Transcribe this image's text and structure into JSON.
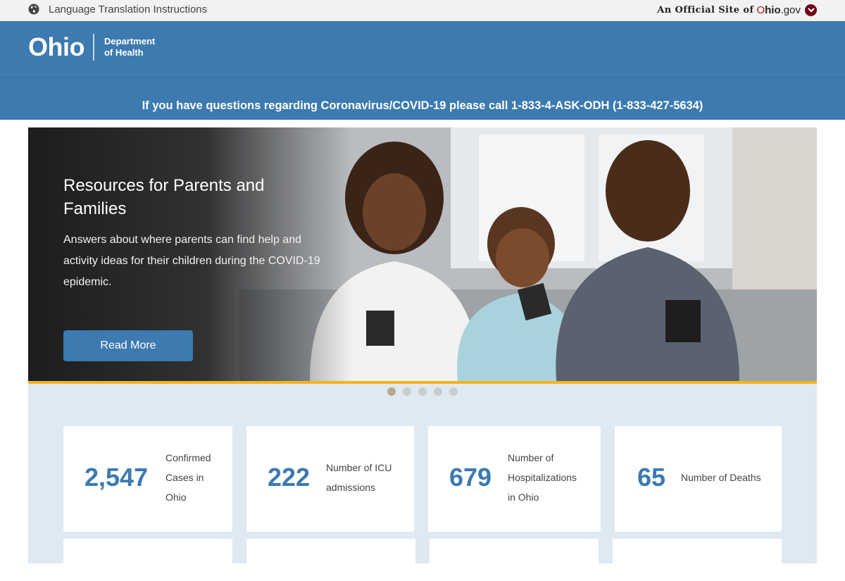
{
  "topbar": {
    "language_link": "Language Translation Instructions",
    "official_prefix": "An Official Site of",
    "ohio_o": "O",
    "ohio_hio": "hio",
    "ohio_gov": ".gov"
  },
  "header": {
    "logo_word": "Ohio",
    "dept_line1": "Department",
    "dept_line2": "of Health"
  },
  "banner": {
    "text": "If you have questions regarding Coronavirus/COVID-19 please call 1-833-4-ASK-ODH (1-833-427-5634)"
  },
  "hero": {
    "title": "Resources for Parents and Families",
    "description": "Answers about where parents can find help and activity ideas for their children during the COVID-19 epidemic.",
    "button_label": "Read More",
    "slide_count": 5,
    "active_slide": 1
  },
  "stats": [
    {
      "value": "2,547",
      "label_lines": [
        "Confirmed",
        "Cases in",
        "Ohio"
      ]
    },
    {
      "value": "222",
      "label_lines": [
        "Number of ICU",
        "admissions"
      ]
    },
    {
      "value": "679",
      "label_lines": [
        "Number of",
        "Hospitalizations",
        "in Ohio"
      ]
    },
    {
      "value": "65",
      "label_lines": [
        "Number of Deaths"
      ]
    }
  ],
  "colors": {
    "brand_blue": "#3c7ab0",
    "accent_gold": "#f2b51f",
    "ohio_red": "#b5121b",
    "stats_bg": "#dfe9f2"
  }
}
